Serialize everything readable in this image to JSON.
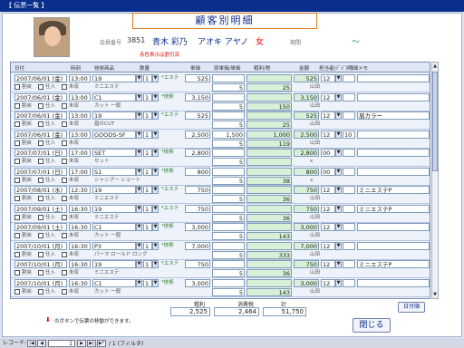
{
  "window_title": "【 伝票一覧 】",
  "header": {
    "title": "顧客別明細",
    "member_label": "会員番号",
    "member_no": "3851",
    "name": "青木 彩乃",
    "kana": "アオキ アヤノ",
    "gender": "女",
    "period_label": "期間",
    "period_sep": "～",
    "note": "赤色表示は割引済"
  },
  "columns": [
    "日付",
    "時刻",
    "技術商品",
    "数量",
    "単価",
    "原単価/単価",
    "粗利/税",
    "金額",
    "担当者(ﾃﾞｼﾞｶﾞ)",
    "明細メモ"
  ],
  "sub_labels": {
    "discount": "割戻",
    "purchase": "仕入",
    "unsettled": "未収",
    "stock": "+技術"
  },
  "records": [
    {
      "date": "2007/06/01 (金)",
      "time": "13:00",
      "item": "19",
      "qty": "1",
      "cat": "*エステ",
      "price": "525",
      "orig": "",
      "tax": "25",
      "amount": "525",
      "staff": "12",
      "memo": "",
      "sub_item": "ミニエステ",
      "sub_qty": "5",
      "sub_staff": "山田"
    },
    {
      "date": "2007/06/01 (金)",
      "time": "13:00",
      "item": "C1",
      "qty": "1",
      "cat": "*技術",
      "price": "3,150",
      "orig": "",
      "tax": "150",
      "amount": "3,150",
      "staff": "12",
      "memo": "",
      "sub_item": "カット 一般",
      "sub_qty": "5",
      "sub_staff": "山田"
    },
    {
      "date": "2007/06/01 (金)",
      "time": "13:00",
      "item": "19",
      "qty": "1",
      "cat": "*エステ",
      "price": "525",
      "orig": "",
      "tax": "25",
      "amount": "525",
      "staff": "12",
      "memo": "眉カラー",
      "sub_item": "眉のCUT",
      "sub_qty": "5",
      "sub_staff": "山田"
    },
    {
      "date": "2007/06/01 (金)",
      "time": "13:00",
      "item": "GOODS-SF",
      "qty": "1",
      "cat": "",
      "price": "2,500",
      "orig": "1,500",
      "tax": "119",
      "amount": "2,500",
      "staff": "12",
      "memo": "",
      "sub_item": "",
      "sub_qty": "5",
      "sub_staff": "山田",
      "extra": "10",
      "margin": "1,000"
    },
    {
      "date": "2007/07/01 (日)",
      "time": "17:00",
      "item": "SET",
      "qty": "1",
      "cat": "*技術",
      "price": "2,800",
      "orig": "",
      "tax": "",
      "amount": "2,800",
      "staff": "00",
      "memo": "",
      "sub_item": "セット",
      "sub_qty": "5",
      "sub_staff": "x"
    },
    {
      "date": "2007/07/01 (日)",
      "time": "17:00",
      "item": "S1",
      "qty": "1",
      "cat": "*技術",
      "price": "800",
      "orig": "",
      "tax": "38",
      "amount": "800",
      "staff": "00",
      "memo": "",
      "sub_item": "シャンプー ショート",
      "sub_qty": "5",
      "sub_staff": "x"
    },
    {
      "date": "2007/08/01 (水)",
      "time": "12:30",
      "item": "19",
      "qty": "1",
      "cat": "*エステ",
      "price": "750",
      "orig": "",
      "tax": "36",
      "amount": "750",
      "staff": "12",
      "memo": "ミニエステP",
      "sub_item": "ミニエステ",
      "sub_qty": "5",
      "sub_staff": "山田"
    },
    {
      "date": "2007/09/01 (土)",
      "time": "16:30",
      "item": "19",
      "qty": "1",
      "cat": "*エステ",
      "price": "750",
      "orig": "",
      "tax": "36",
      "amount": "750",
      "staff": "12",
      "memo": "ミニエステP",
      "sub_item": "ミニエステ",
      "sub_qty": "5",
      "sub_staff": "山田"
    },
    {
      "date": "2007/09/01 (土)",
      "time": "16:30",
      "item": "C1",
      "qty": "1",
      "cat": "*技術",
      "price": "3,000",
      "orig": "",
      "tax": "143",
      "amount": "3,000",
      "staff": "12",
      "memo": "",
      "sub_item": "カット 一般",
      "sub_qty": "5",
      "sub_staff": "山田"
    },
    {
      "date": "2007/10/01 (月)",
      "time": "16:30",
      "item": "P3",
      "qty": "1",
      "cat": "*技術",
      "price": "7,000",
      "orig": "",
      "tax": "333",
      "amount": "7,000",
      "staff": "12",
      "memo": "",
      "sub_item": "パーマ ロールド ロング",
      "sub_qty": "5",
      "sub_staff": "山田"
    },
    {
      "date": "2007/10/01 (月)",
      "time": "16:30",
      "item": "19",
      "qty": "1",
      "cat": "*エステ",
      "price": "750",
      "orig": "",
      "tax": "36",
      "amount": "750",
      "staff": "12",
      "memo": "ミニエステP",
      "sub_item": "ミニエステ",
      "sub_qty": "5",
      "sub_staff": "山田"
    },
    {
      "date": "2007/10/01 (月)",
      "time": "16:30",
      "item": "C1",
      "qty": "1",
      "cat": "*技術",
      "price": "3,000",
      "orig": "",
      "tax": "143",
      "amount": "3,000",
      "staff": "12",
      "memo": "",
      "sub_item": "カット 一般",
      "sub_qty": "5",
      "sub_staff": "山田"
    }
  ],
  "totals": {
    "gross_label": "粗利",
    "tax_label": "消費税",
    "total_label": "計",
    "gross": "2,525",
    "tax": "2,464",
    "total": "51,750"
  },
  "footer_note": "のボタンで伝票の移動ができます。",
  "buttons": {
    "detail": "日付順",
    "close": "閉じる"
  },
  "statusbar": {
    "label": "レコード:",
    "current": "1",
    "total": "/ 1 (フィルタ)"
  }
}
